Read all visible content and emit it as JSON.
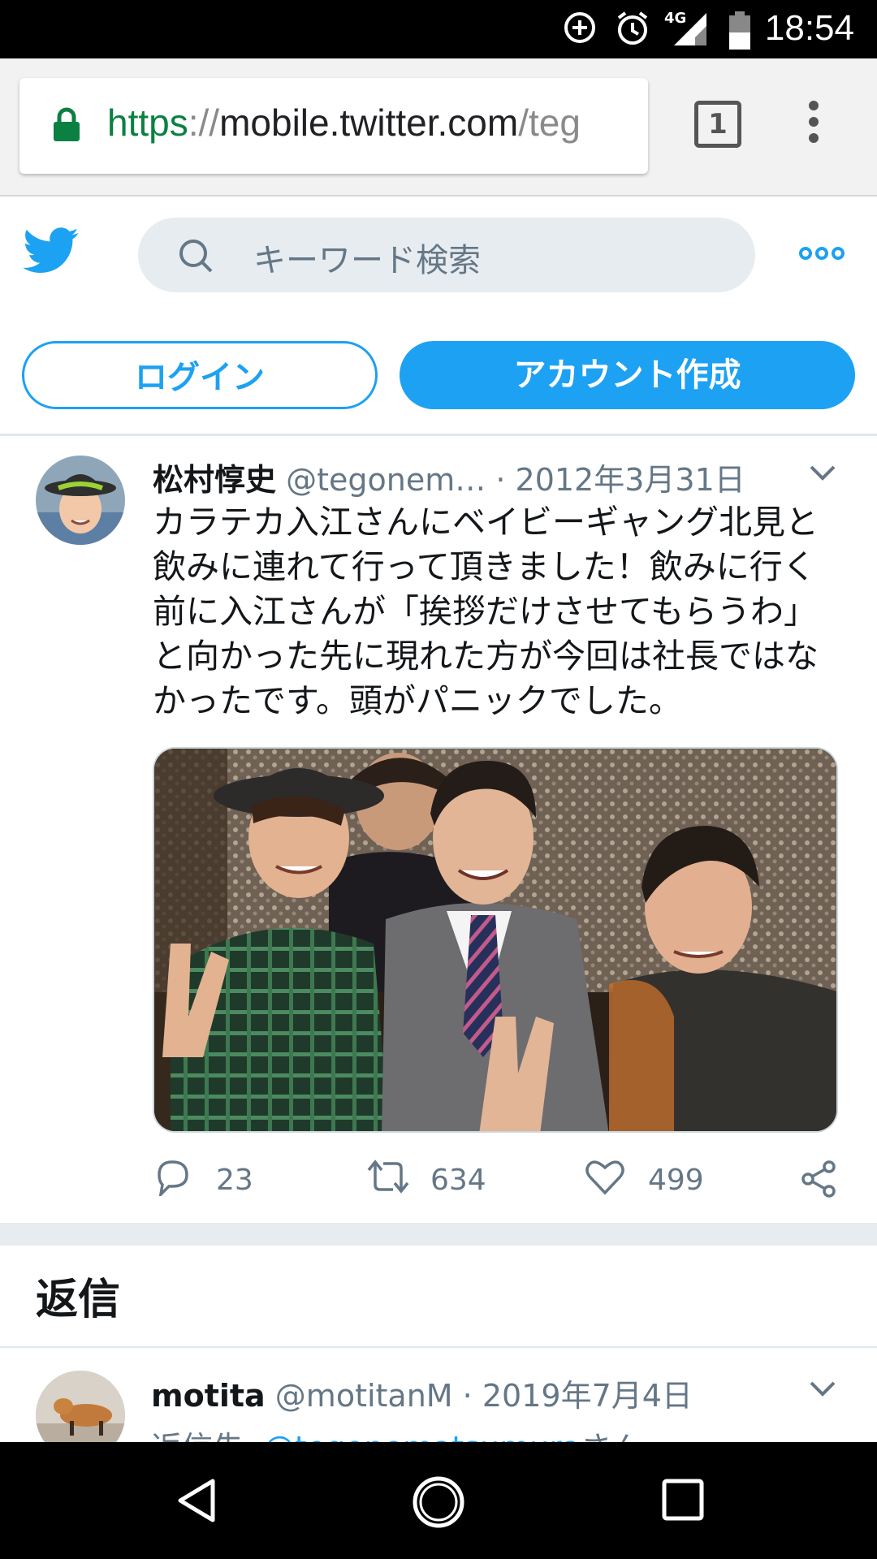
{
  "status_bar": {
    "time": "18:54",
    "network": "4G"
  },
  "browser": {
    "url": {
      "scheme": "https",
      "sep": "://",
      "host": "mobile.twitter.com",
      "path": "/teg"
    },
    "tab_count": "1"
  },
  "twitter": {
    "search_placeholder": "キーワード検索",
    "login_label": "ログイン",
    "signup_label": "アカウント作成"
  },
  "tweet": {
    "name": "松村惇史",
    "handle": "@tegonem…",
    "dot": "·",
    "date": "2012年3月31日",
    "text": "カラテカ入江さんにベイビーギャング北見と\n飲みに連れて行って頂きました！飲みに行く\n前に入江さんが「挨拶だけさせてもらうわ」\nと向かった先に現れた方が今回は社長ではな\nかったです。頭がパニックでした。",
    "reply_count": "23",
    "retweet_count": "634",
    "like_count": "499"
  },
  "replies_section": {
    "title": "返信"
  },
  "reply": {
    "name": "motita",
    "handle": "@motitanM",
    "dot": "·",
    "date": "2019年7月4日",
    "reply_to_prefix": "返信先: ",
    "reply_to_link": "@tegonematsumura",
    "reply_to_suffix": "さん"
  },
  "colors": {
    "twitter_blue": "#1da1f2",
    "secure_green": "#0b8043",
    "muted": "#657786"
  }
}
